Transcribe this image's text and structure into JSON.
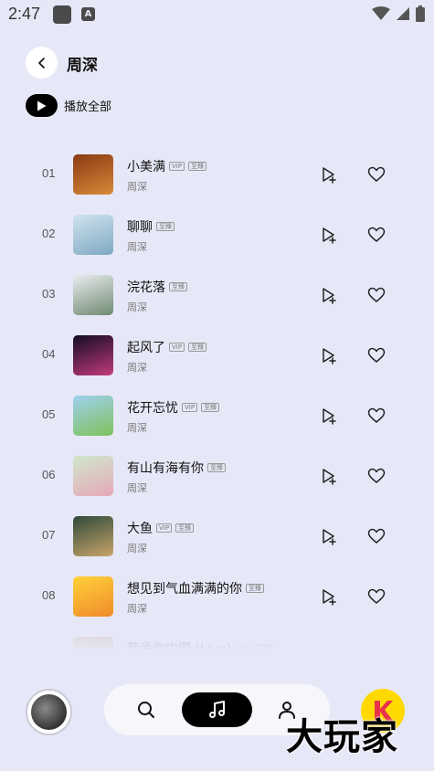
{
  "status_bar": {
    "time": "2:47",
    "icons": [
      "app-icon",
      "a-icon",
      "wifi-icon",
      "cellular-icon",
      "battery-icon"
    ]
  },
  "header": {
    "title": "周深",
    "back_icon": "chevron-left-icon"
  },
  "play_all": {
    "label": "播放全部",
    "icon": "play-icon"
  },
  "songs": [
    {
      "index": "01",
      "title": "小美满",
      "badges": [
        "VIP",
        "至臻"
      ],
      "artist": "周深",
      "cover_color": "#8a3a12",
      "cover_color2": "#d88a3a"
    },
    {
      "index": "02",
      "title": "聊聊",
      "badges": [
        "至臻"
      ],
      "artist": "周深",
      "cover_color": "#cfe3ee",
      "cover_color2": "#7fa9c2"
    },
    {
      "index": "03",
      "title": "浣花落",
      "badges": [
        "至臻"
      ],
      "artist": "周深",
      "cover_color": "#e9ecef",
      "cover_color2": "#6f8a72"
    },
    {
      "index": "04",
      "title": "起风了",
      "badges": [
        "VIP",
        "至臻"
      ],
      "artist": "周深",
      "cover_color": "#120c26",
      "cover_color2": "#c23a7a"
    },
    {
      "index": "05",
      "title": "花开忘忧",
      "badges": [
        "VIP",
        "至臻"
      ],
      "artist": "周深",
      "cover_color": "#9fd0f0",
      "cover_color2": "#7ec25a"
    },
    {
      "index": "06",
      "title": "有山有海有你",
      "badges": [
        "至臻"
      ],
      "artist": "周深",
      "cover_color": "#cfe7cc",
      "cover_color2": "#e6a8b8"
    },
    {
      "index": "07",
      "title": "大鱼",
      "badges": [
        "VIP",
        "至臻"
      ],
      "artist": "周深",
      "cover_color": "#2f4a3a",
      "cover_color2": "#c8a46a"
    },
    {
      "index": "08",
      "title": "想见到气血满满的你",
      "badges": [
        "至臻"
      ],
      "artist": "周深",
      "cover_color": "#ffd23a",
      "cover_color2": "#f08a2a"
    },
    {
      "index": "09",
      "title": "我爱你中国 (Live)",
      "badges": [
        "VIP",
        "至臻"
      ],
      "artist": "周深",
      "cover_color": "#cbb89a",
      "cover_color2": "#8a7a5a"
    }
  ],
  "row_actions": {
    "next_icon": "play-next-icon",
    "like_icon": "heart-icon"
  },
  "bottom_nav": {
    "items": [
      "search-icon",
      "music-note-icon",
      "profile-icon"
    ],
    "active": "music-note-icon"
  },
  "watermark": {
    "text": "大玩家"
  },
  "colors": {
    "background": "#e7e8f7",
    "primary": "#000000",
    "nav_background": "#f6f6fb",
    "badge_border": "#999999"
  }
}
